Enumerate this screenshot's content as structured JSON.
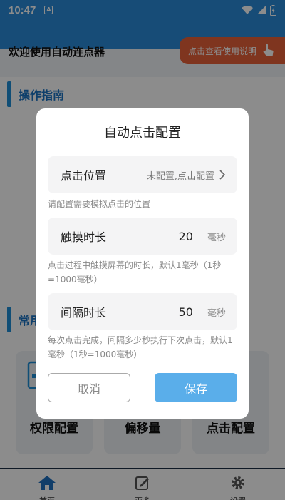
{
  "status_bar": {
    "time": "10:47",
    "notification_letter": "A"
  },
  "app": {
    "title": "欢迎使用自动连点器",
    "guide_button_label": "点击查看使用说明",
    "sections": [
      "操作指南",
      "常用"
    ],
    "feature_cards": [
      "权限配置",
      "偏移量",
      "点击配置"
    ],
    "nav": [
      "首页",
      "更多",
      "设置"
    ]
  },
  "dialog": {
    "title": "自动点击配置",
    "position": {
      "label": "点击位置",
      "value": "未配置,点击配置",
      "hint": "请配置需要模拟点击的位置"
    },
    "touch_duration": {
      "label": "触摸时长",
      "value": "20",
      "unit": "毫秒",
      "hint": "点击过程中触摸屏幕的时长，默认1毫秒（1秒=1000毫秒）"
    },
    "interval": {
      "label": "间隔时长",
      "value": "50",
      "unit": "毫秒",
      "hint": "每次点击完成，间隔多少秒执行下次点击，默认1毫秒（1秒=1000毫秒）"
    },
    "cancel_label": "取消",
    "save_label": "保存"
  },
  "colors": {
    "accent": "#2a8bd9",
    "save": "#5aaeea",
    "guide": "#e8623a"
  }
}
